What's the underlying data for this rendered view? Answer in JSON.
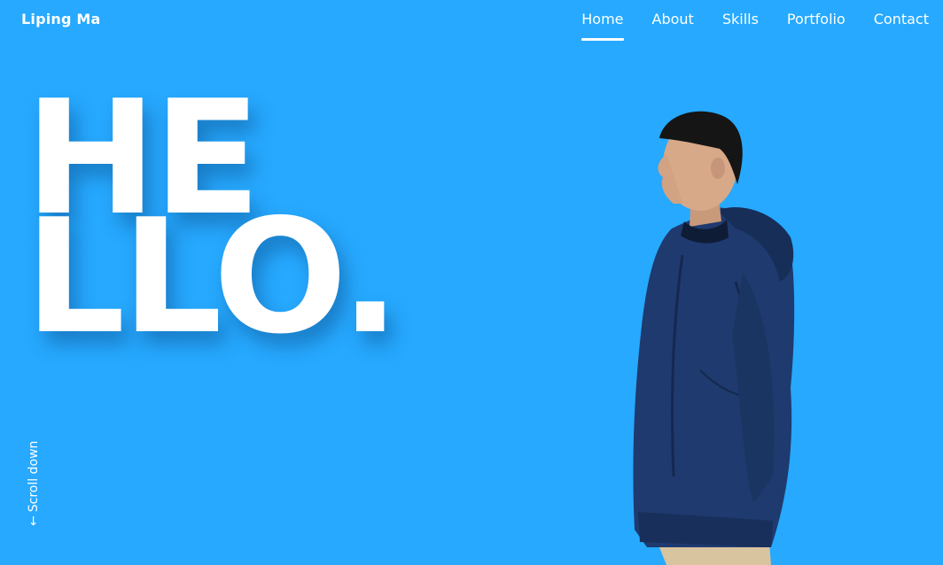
{
  "brand": {
    "name": "Liping Ma"
  },
  "nav": {
    "items": [
      {
        "label": "Home",
        "active": true
      },
      {
        "label": "About",
        "active": false
      },
      {
        "label": "Skills",
        "active": false
      },
      {
        "label": "Portfolio",
        "active": false
      },
      {
        "label": "Contact",
        "active": false
      }
    ]
  },
  "hero": {
    "line1": "HE",
    "line2": "LLO."
  },
  "scroll": {
    "arrow": "←",
    "label": "Scroll down"
  },
  "colors": {
    "background": "#26a9ff",
    "text": "#ffffff",
    "jacket": "#1f3a6e",
    "pants": "#d9c4a0"
  },
  "icons": {
    "scroll_arrow": "arrow-down-icon",
    "photo": "person-photo"
  }
}
